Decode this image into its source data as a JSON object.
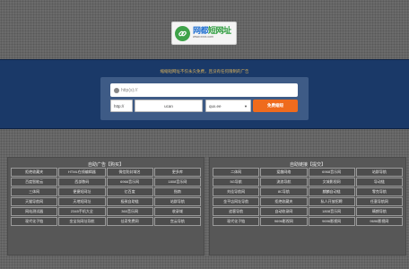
{
  "logo": {
    "name_part1": "网都",
    "name_part2": "短网址",
    "url": "www.xxxx.com"
  },
  "notice": "缩缩短网址不仅永久免费，且没有任何限制的广告",
  "url_input": {
    "placeholder": "http(s)://"
  },
  "form": {
    "protocol": "http://",
    "code": "ucan",
    "domain": "qux.ee",
    "submit_label": "免费缩短"
  },
  "colors": {
    "band": "#1a3968",
    "submit": "#ef6b1d",
    "notice": "#e0b55a"
  },
  "ads": {
    "title": "自助广告【购买】",
    "items": [
      "拒绝收藏夹",
      "HTML在线编辑器",
      "微信防封域名",
      "更多库",
      "百度智能云",
      "西部数码",
      "6966音乐网",
      "1808音乐网",
      "三体网",
      "便捷短网址",
      "亿百度",
      "指南",
      "天猫导航网",
      "天地短网址",
      "极致自助链",
      "站群导航",
      "网站测试器",
      "2345手机大全",
      "360音乐网",
      "收录域",
      "现代化子链",
      "金宝坑网址导航",
      "佳奇免费网",
      "宫云导航"
    ]
  },
  "links": {
    "title": "自助链接【提交】",
    "items": [
      "二体网",
      "爱趣网络",
      "6968音乐网",
      "站群导航",
      "5G导航",
      "流浪导航",
      "文城影视网",
      "导动链",
      "刘佳导航网",
      "8C导航",
      "麒麟自动链",
      "零克导航",
      "金平店网址导航",
      "拒绝收藏夹",
      "私人开放招聘",
      "任意导航网",
      "追客导航",
      "自动收录网",
      "1808音乐网",
      "晴朗导航",
      "现代化子链",
      "9696影视网",
      "9696影视网",
      "9696影视网"
    ]
  }
}
